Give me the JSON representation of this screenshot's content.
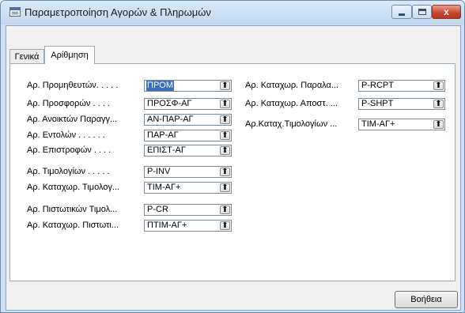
{
  "window": {
    "title": "Παραμετροποίηση Αγορών & Πληρωμών",
    "close_glyph": "x"
  },
  "tabs": [
    {
      "label": "Γενικά",
      "active": false
    },
    {
      "label": "Αρίθμηση",
      "active": true
    }
  ],
  "left_fields": [
    {
      "label": "Αρ. Προμηθευτών. . . . .",
      "value": "ΠΡΟΜ",
      "selected": true
    },
    {
      "label": "Αρ. Προσφορών  . . . .",
      "value": "ΠΡΟΣΦ-ΑΓ",
      "selected": false
    },
    {
      "label": "Αρ. Ανοικτών Παραγγ...",
      "value": "ΑΝ-ΠΑΡ-ΑΓ",
      "selected": false
    },
    {
      "label": "Αρ. Εντολών . . . . . .",
      "value": "ΠΑΡ-ΑΓ",
      "selected": false
    },
    {
      "label": "Αρ. Επιστροφών  . . . .",
      "value": "ΕΠΙΣΤ-ΑΓ",
      "selected": false
    },
    {
      "label": "Αρ. Τιμολογίων . . . . .",
      "value": "P-INV",
      "selected": false
    },
    {
      "label": "Αρ. Καταχωρ. Τιμολογ...",
      "value": "ΤΙΜ-ΑΓ+",
      "selected": false
    },
    {
      "label": "Αρ. Πιστωτικών Τιμολ...",
      "value": "P-CR",
      "selected": false
    },
    {
      "label": "Αρ. Καταχωρ. Πιστωτι...",
      "value": "ΠΤΙΜ-ΑΓ+",
      "selected": false
    }
  ],
  "right_fields": [
    {
      "label": "Αρ. Καταχωρ. Παραλα...",
      "value": "P-RCPT"
    },
    {
      "label": "Αρ. Καταχωρ. Αποστ. ...",
      "value": "P-SHPT"
    },
    {
      "label": "Αρ.Καταχ.Τιμολογίων ...",
      "value": "ΤΙΜ-ΑΓ+"
    }
  ],
  "buttons": {
    "help_label": "Βοήθεια"
  },
  "colors": {
    "selection": "#3a6fc4",
    "close_button": "#c8432b"
  }
}
